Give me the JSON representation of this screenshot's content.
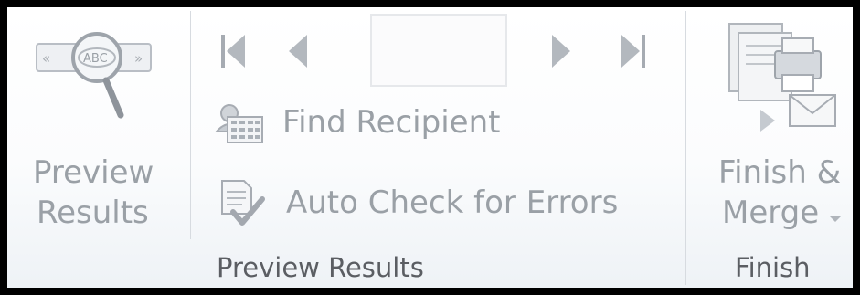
{
  "preview_group": {
    "big_button": {
      "line1": "Preview",
      "line2": "Results",
      "icon": "magnifier-abc-icon"
    },
    "nav": {
      "first_icon": "first-record-icon",
      "prev_icon": "previous-record-icon",
      "record_value": "",
      "next_icon": "next-record-icon",
      "last_icon": "last-record-icon"
    },
    "find_recipient": {
      "label": "Find Recipient",
      "icon": "find-recipient-icon"
    },
    "auto_check": {
      "label": "Auto Check for Errors",
      "icon": "auto-check-icon"
    },
    "group_label": "Preview Results"
  },
  "finish_group": {
    "big_button": {
      "line1": "Finish &",
      "line2": "Merge",
      "icon": "finish-merge-icon"
    },
    "group_label": "Finish"
  }
}
